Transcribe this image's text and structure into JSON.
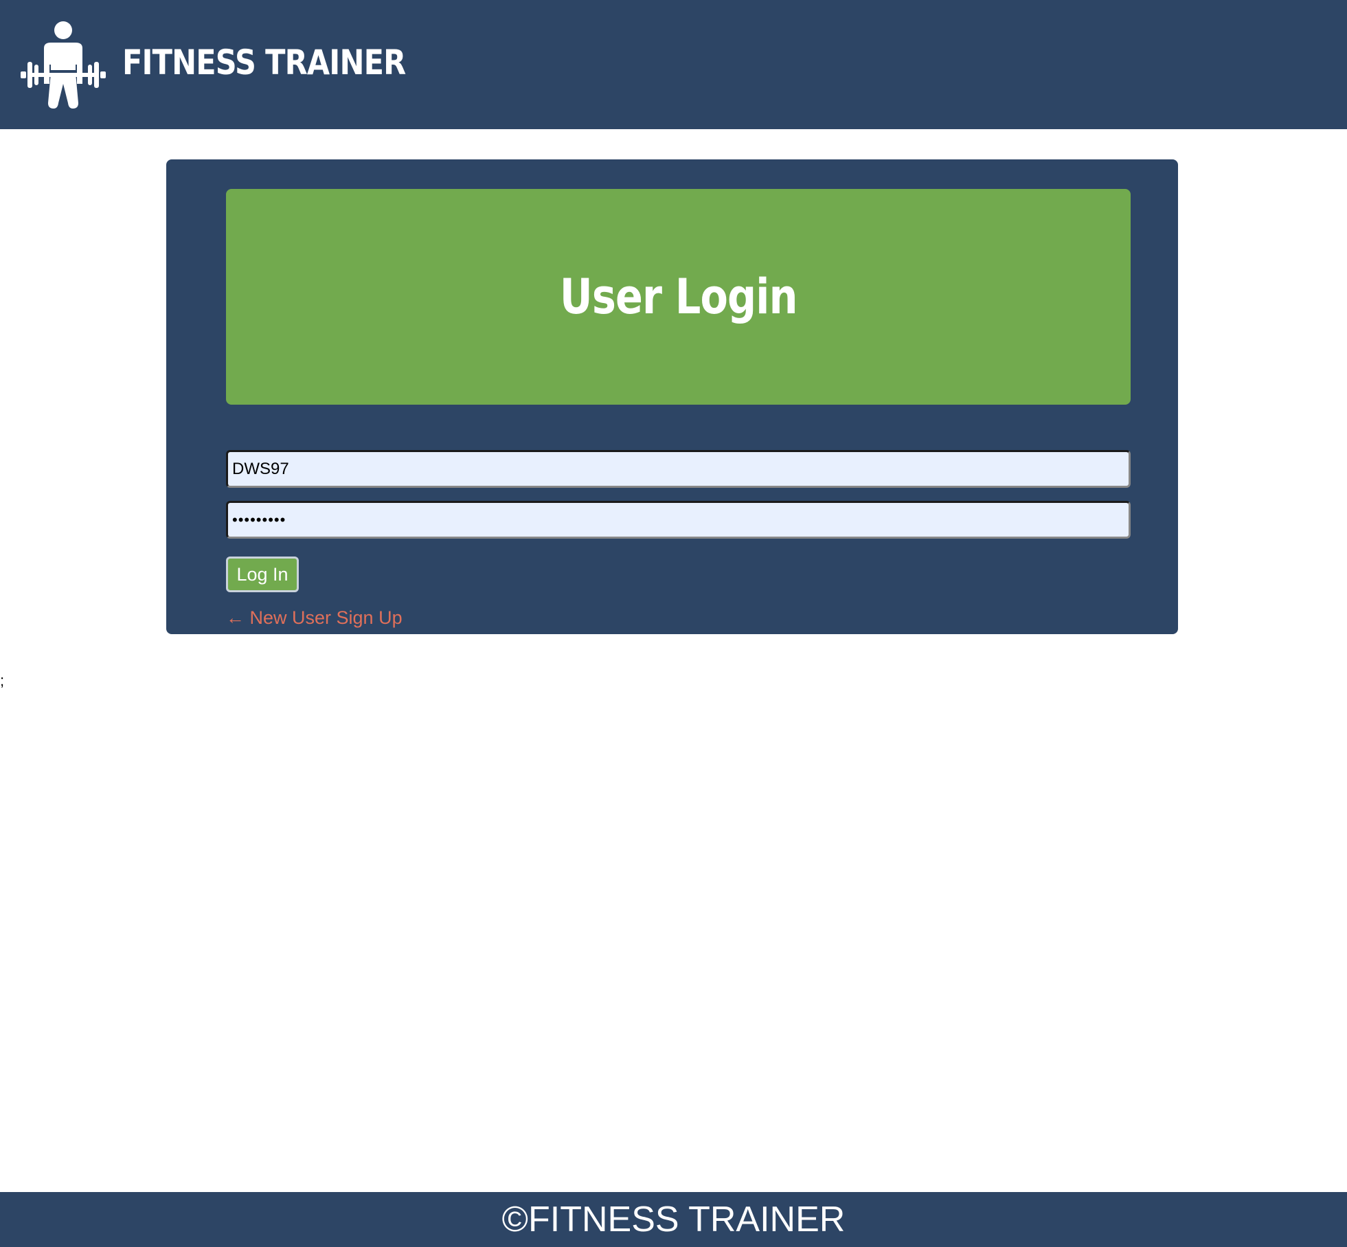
{
  "header": {
    "brand": "FITNESS TRAINER",
    "logo_icon": "weightlifter-icon"
  },
  "login_card": {
    "title": "User Login",
    "username": {
      "value": "DWS97"
    },
    "password": {
      "value": "•••••••••"
    },
    "submit_label": "Log In",
    "signup_link": "← New User Sign Up"
  },
  "stray_text": ";",
  "footer": {
    "text": "©FITNESS TRAINER"
  },
  "colors": {
    "navy": "#2d4565",
    "green": "#72aa4e",
    "link": "#e0705a",
    "input_bg": "#e8f0fe"
  }
}
